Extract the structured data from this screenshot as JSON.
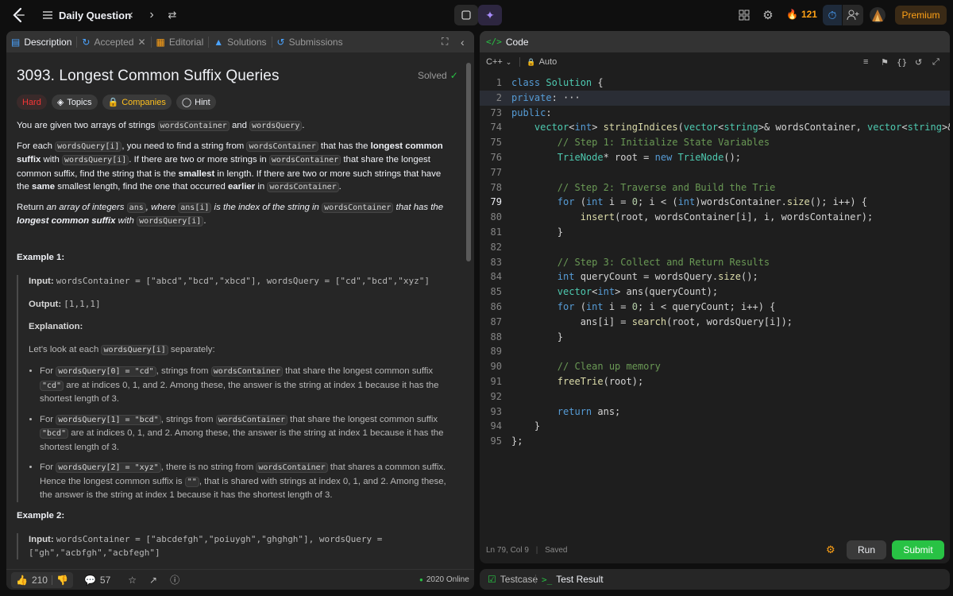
{
  "header": {
    "title": "Daily Question",
    "streak": "121",
    "premium": "Premium"
  },
  "left_tabs": [
    {
      "label": "Description"
    },
    {
      "label": "Accepted"
    },
    {
      "label": "Editorial"
    },
    {
      "label": "Solutions"
    },
    {
      "label": "Submissions"
    }
  ],
  "problem": {
    "title": "3093. Longest Common Suffix Queries",
    "status": "Solved",
    "chips": [
      "Hard",
      "Topics",
      "Companies",
      "Hint"
    ],
    "intro_a": "You are given two arrays of strings ",
    "intro_code1": "wordsContainer",
    "intro_b": " and ",
    "intro_code2": "wordsQuery",
    "intro_c": ".",
    "p2_a": "For each ",
    "p2_code1": "wordsQuery[i]",
    "p2_b": ", you need to find a string from ",
    "p2_code2": "wordsContainer",
    "p2_c": " that has the ",
    "p2_bold1": "longest common suffix",
    "p2_d": " with ",
    "p2_code3": "wordsQuery[i]",
    "p2_e": ". If there are two or more strings in ",
    "p2_code4": "wordsContainer",
    "p2_f": " that share the longest common suffix, find the string that is the ",
    "p2_bold2": "smallest",
    "p2_g": " in length. If there are two or more such strings that have the ",
    "p2_bold3": "same",
    "p2_h": " smallest length, find the one that occurred ",
    "p2_bold4": "earlier",
    "p2_i": " in ",
    "p2_code5": "wordsContainer",
    "p2_j": ".",
    "p3_a": "Return ",
    "p3_i1": "an array of integers ",
    "p3_code1": "ans",
    "p3_i2": ", where ",
    "p3_code2": "ans[i]",
    "p3_i3": " is the index of the string in ",
    "p3_code3": "wordsContainer",
    "p3_i4": " that has the ",
    "p3_bold": "longest common suffix",
    "p3_i5": " with ",
    "p3_code4": "wordsQuery[i]",
    "p3_end": ".",
    "ex1_title": "Example 1:",
    "ex1_input_label": "Input:",
    "ex1_input": "wordsContainer = [\"abcd\",\"bcd\",\"xbcd\"], wordsQuery = [\"cd\",\"bcd\",\"xyz\"]",
    "ex1_output_label": "Output:",
    "ex1_output": "[1,1,1]",
    "ex1_expl_label": "Explanation:",
    "ex1_look_a": "Let's look at each ",
    "ex1_look_code": "wordsQuery[i]",
    "ex1_look_b": " separately:",
    "b1_a": "For ",
    "b1_code1": "wordsQuery[0] = \"cd\"",
    "b1_b": ", strings from ",
    "b1_code2": "wordsContainer",
    "b1_c": " that share the longest common suffix ",
    "b1_code3": "\"cd\"",
    "b1_d": " are at indices 0, 1, and 2. Among these, the answer is the string at index 1 because it has the shortest length of 3.",
    "b2_a": "For ",
    "b2_code1": "wordsQuery[1] = \"bcd\"",
    "b2_b": ", strings from ",
    "b2_code2": "wordsContainer",
    "b2_c": " that share the longest common suffix ",
    "b2_code3": "\"bcd\"",
    "b2_d": " are at indices 0, 1, and 2. Among these, the answer is the string at index 1 because it has the shortest length of 3.",
    "b3_a": "For ",
    "b3_code1": "wordsQuery[2] = \"xyz\"",
    "b3_b": ", there is no string from ",
    "b3_code2": "wordsContainer",
    "b3_c": " that shares a common suffix. Hence the longest common suffix is ",
    "b3_code3": "\"\"",
    "b3_d": ", that is shared with strings at index 0, 1, and 2. Among these, the answer is the string at index 1 because it has the shortest length of 3.",
    "ex2_title": "Example 2:",
    "ex2_input_label": "Input:",
    "ex2_input": "wordsContainer = [\"abcdefgh\",\"poiuygh\",\"ghghgh\"], wordsQuery = [\"gh\",\"acbfgh\",\"acbfegh\"]"
  },
  "footer": {
    "likes": "210",
    "comments": "57",
    "online": "2020 Online"
  },
  "code_panel": {
    "tab": "Code",
    "language": "C++",
    "mode": "Auto",
    "status_pos": "Ln 79, Col 9",
    "status_saved": "Saved",
    "run": "Run",
    "submit": "Submit"
  },
  "result_tabs": {
    "testcase": "Testcase",
    "result": "Test Result"
  },
  "code_lines": [
    {
      "n": "1",
      "t": "class Solution {"
    },
    {
      "n": "2",
      "t": "private: ···"
    },
    {
      "n": "73",
      "t": "public:"
    },
    {
      "n": "74",
      "t": "    vector<int> stringIndices(vector<string>& wordsContainer, vector<string>& wordsQuery) {"
    },
    {
      "n": "75",
      "t": "        // Step 1: Initialize State Variables"
    },
    {
      "n": "76",
      "t": "        TrieNode* root = new TrieNode();"
    },
    {
      "n": "77",
      "t": ""
    },
    {
      "n": "78",
      "t": "        // Step 2: Traverse and Build the Trie"
    },
    {
      "n": "79",
      "t": "        for (int i = 0; i < (int)wordsContainer.size(); i++) {"
    },
    {
      "n": "80",
      "t": "            insert(root, wordsContainer[i], i, wordsContainer);"
    },
    {
      "n": "81",
      "t": "        }"
    },
    {
      "n": "82",
      "t": ""
    },
    {
      "n": "83",
      "t": "        // Step 3: Collect and Return Results"
    },
    {
      "n": "84",
      "t": "        int queryCount = wordsQuery.size();"
    },
    {
      "n": "85",
      "t": "        vector<int> ans(queryCount);"
    },
    {
      "n": "86",
      "t": "        for (int i = 0; i < queryCount; i++) {"
    },
    {
      "n": "87",
      "t": "            ans[i] = search(root, wordsQuery[i]);"
    },
    {
      "n": "88",
      "t": "        }"
    },
    {
      "n": "89",
      "t": ""
    },
    {
      "n": "90",
      "t": "        // Clean up memory"
    },
    {
      "n": "91",
      "t": "        freeTrie(root);"
    },
    {
      "n": "92",
      "t": ""
    },
    {
      "n": "93",
      "t": "        return ans;"
    },
    {
      "n": "94",
      "t": "    }"
    },
    {
      "n": "95",
      "t": "};"
    }
  ]
}
